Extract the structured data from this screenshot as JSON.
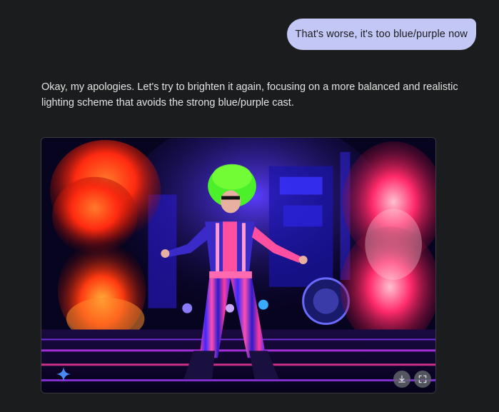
{
  "chat": {
    "user_message": "That's worse, it's too blue/purple now",
    "assistant_message": "Okay, my apologies. Let's try to brighten it again, focusing on a more balanced and realistic lighting scheme that avoids the strong blue/purple cast."
  },
  "image": {
    "description_icon": "sparkle-icon",
    "actions": [
      {
        "name": "download-icon"
      },
      {
        "name": "fullscreen-icon"
      }
    ]
  },
  "colors": {
    "background": "#1b1c1d",
    "user_bubble": "#c2c7f5",
    "text": "#e3e3e3",
    "sparkle": "#4a8cf7"
  }
}
